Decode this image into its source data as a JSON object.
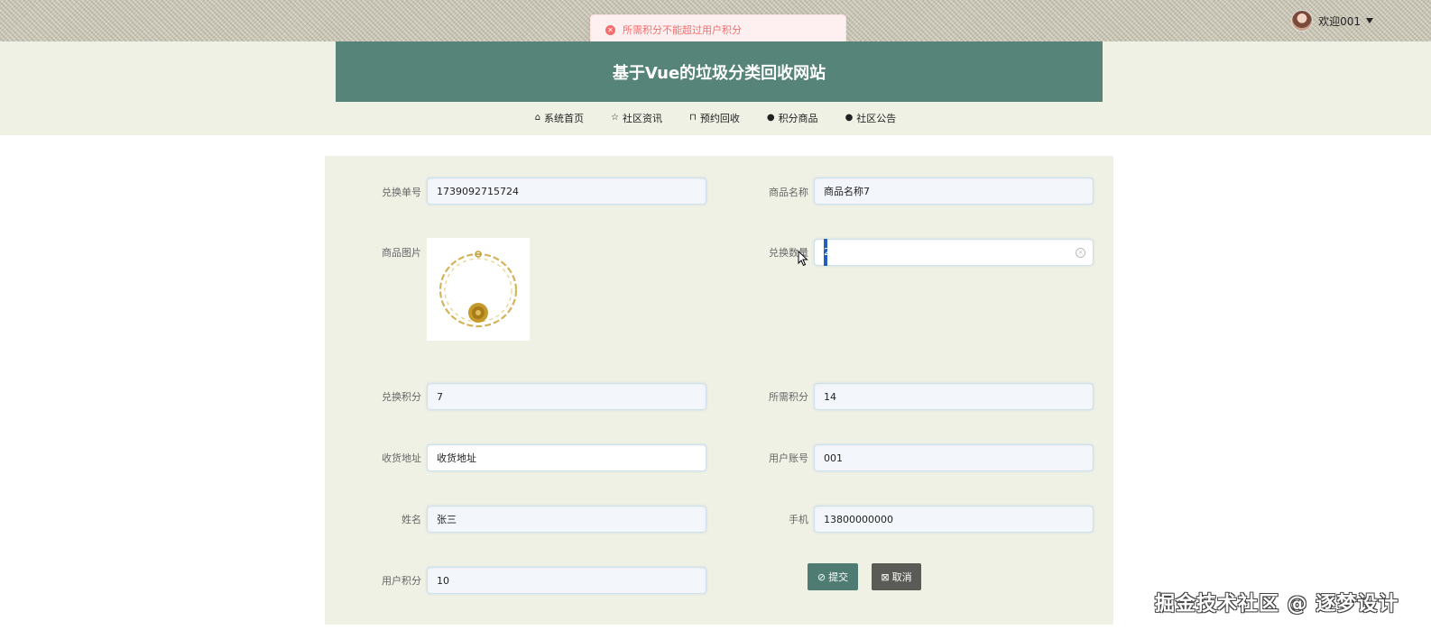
{
  "toast": {
    "message": "所需积分不能超过用户积分",
    "type": "error"
  },
  "user": {
    "greeting": "欢迎001"
  },
  "site": {
    "title": "基于Vue的垃圾分类回收网站"
  },
  "nav": {
    "items": [
      {
        "label": "系统首页",
        "icon": "home-icon"
      },
      {
        "label": "社区资讯",
        "icon": "star-icon"
      },
      {
        "label": "预约回收",
        "icon": "bag-icon"
      },
      {
        "label": "积分商品",
        "icon": "info-icon"
      },
      {
        "label": "社区公告",
        "icon": "question-icon"
      }
    ]
  },
  "form": {
    "order_no": {
      "label": "兑换单号",
      "value": "1739092715724"
    },
    "product_name": {
      "label": "商品名称",
      "value": "商品名称7"
    },
    "product_image": {
      "label": "商品图片"
    },
    "quantity": {
      "label": "兑换数量",
      "value": "2"
    },
    "exchange_points": {
      "label": "兑换积分",
      "value": "7"
    },
    "required_points": {
      "label": "所需积分",
      "value": "14"
    },
    "address": {
      "label": "收货地址",
      "value": "收货地址"
    },
    "account": {
      "label": "用户账号",
      "value": "001"
    },
    "name": {
      "label": "姓名",
      "value": "张三"
    },
    "phone": {
      "label": "手机",
      "value": "13800000000"
    },
    "user_points": {
      "label": "用户积分",
      "value": "10"
    }
  },
  "buttons": {
    "submit": "提交",
    "cancel": "取消"
  },
  "watermark": "掘金技术社区 @ 逐梦设计",
  "colors": {
    "primary": "#568479",
    "panel": "#f0f1e5",
    "error": "#f56c6c"
  }
}
